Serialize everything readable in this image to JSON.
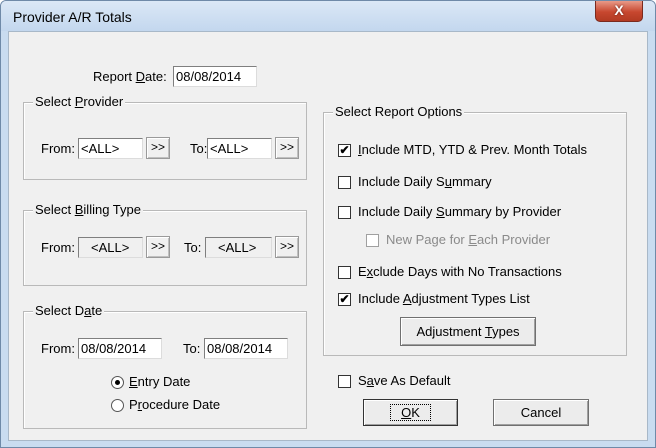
{
  "window": {
    "title": "Provider A/R Totals",
    "close_glyph": "X"
  },
  "report_date": {
    "label_pre": "Report ",
    "label_u": "D",
    "label_post": "ate:",
    "value": "08/08/2014"
  },
  "provider": {
    "legend_pre": "Select ",
    "legend_u": "P",
    "legend_post": "rovider",
    "from_label": "From:",
    "from_value": "<ALL>",
    "to_label": "To:",
    "to_value": "<ALL>",
    "pick_label": ">>"
  },
  "billing": {
    "legend_pre": "Select ",
    "legend_u": "B",
    "legend_post": "illing Type",
    "from_label": "From:",
    "from_value": "<ALL>",
    "to_label": "To:",
    "to_value": "<ALL>",
    "pick_label": ">>"
  },
  "date": {
    "legend_pre": "Select D",
    "legend_u": "a",
    "legend_post": "te",
    "from_label": "From:",
    "from_value": "08/08/2014",
    "to_label": "To:",
    "to_value": "08/08/2014",
    "entry_pre": "",
    "entry_u": "E",
    "entry_post": "ntry Date",
    "proc_pre": "P",
    "proc_u": "r",
    "proc_post": "ocedure Date"
  },
  "options": {
    "legend": "Select Report Options",
    "o1_pre": "",
    "o1_u": "I",
    "o1_post": "nclude MTD, YTD & Prev. Month Totals",
    "o2_pre": "Include Daily S",
    "o2_u": "u",
    "o2_post": "mmary",
    "o3_pre": "Include Daily ",
    "o3_u": "S",
    "o3_post": "ummary by Provider",
    "o4_pre": "New Page for ",
    "o4_u": "E",
    "o4_post": "ach Provider",
    "o5_pre": "E",
    "o5_u": "x",
    "o5_post": "clude Days with No Transactions",
    "o6_pre": "Include ",
    "o6_u": "A",
    "o6_post": "djustment Types List",
    "adj_pre": "Adjustment ",
    "adj_u": "T",
    "adj_post": "ypes",
    "check_glyph": "✔"
  },
  "footer": {
    "save_pre": "S",
    "save_u": "a",
    "save_post": "ve As Default",
    "ok_pre": "",
    "ok_u": "O",
    "ok_post": "K",
    "cancel": "Cancel"
  }
}
